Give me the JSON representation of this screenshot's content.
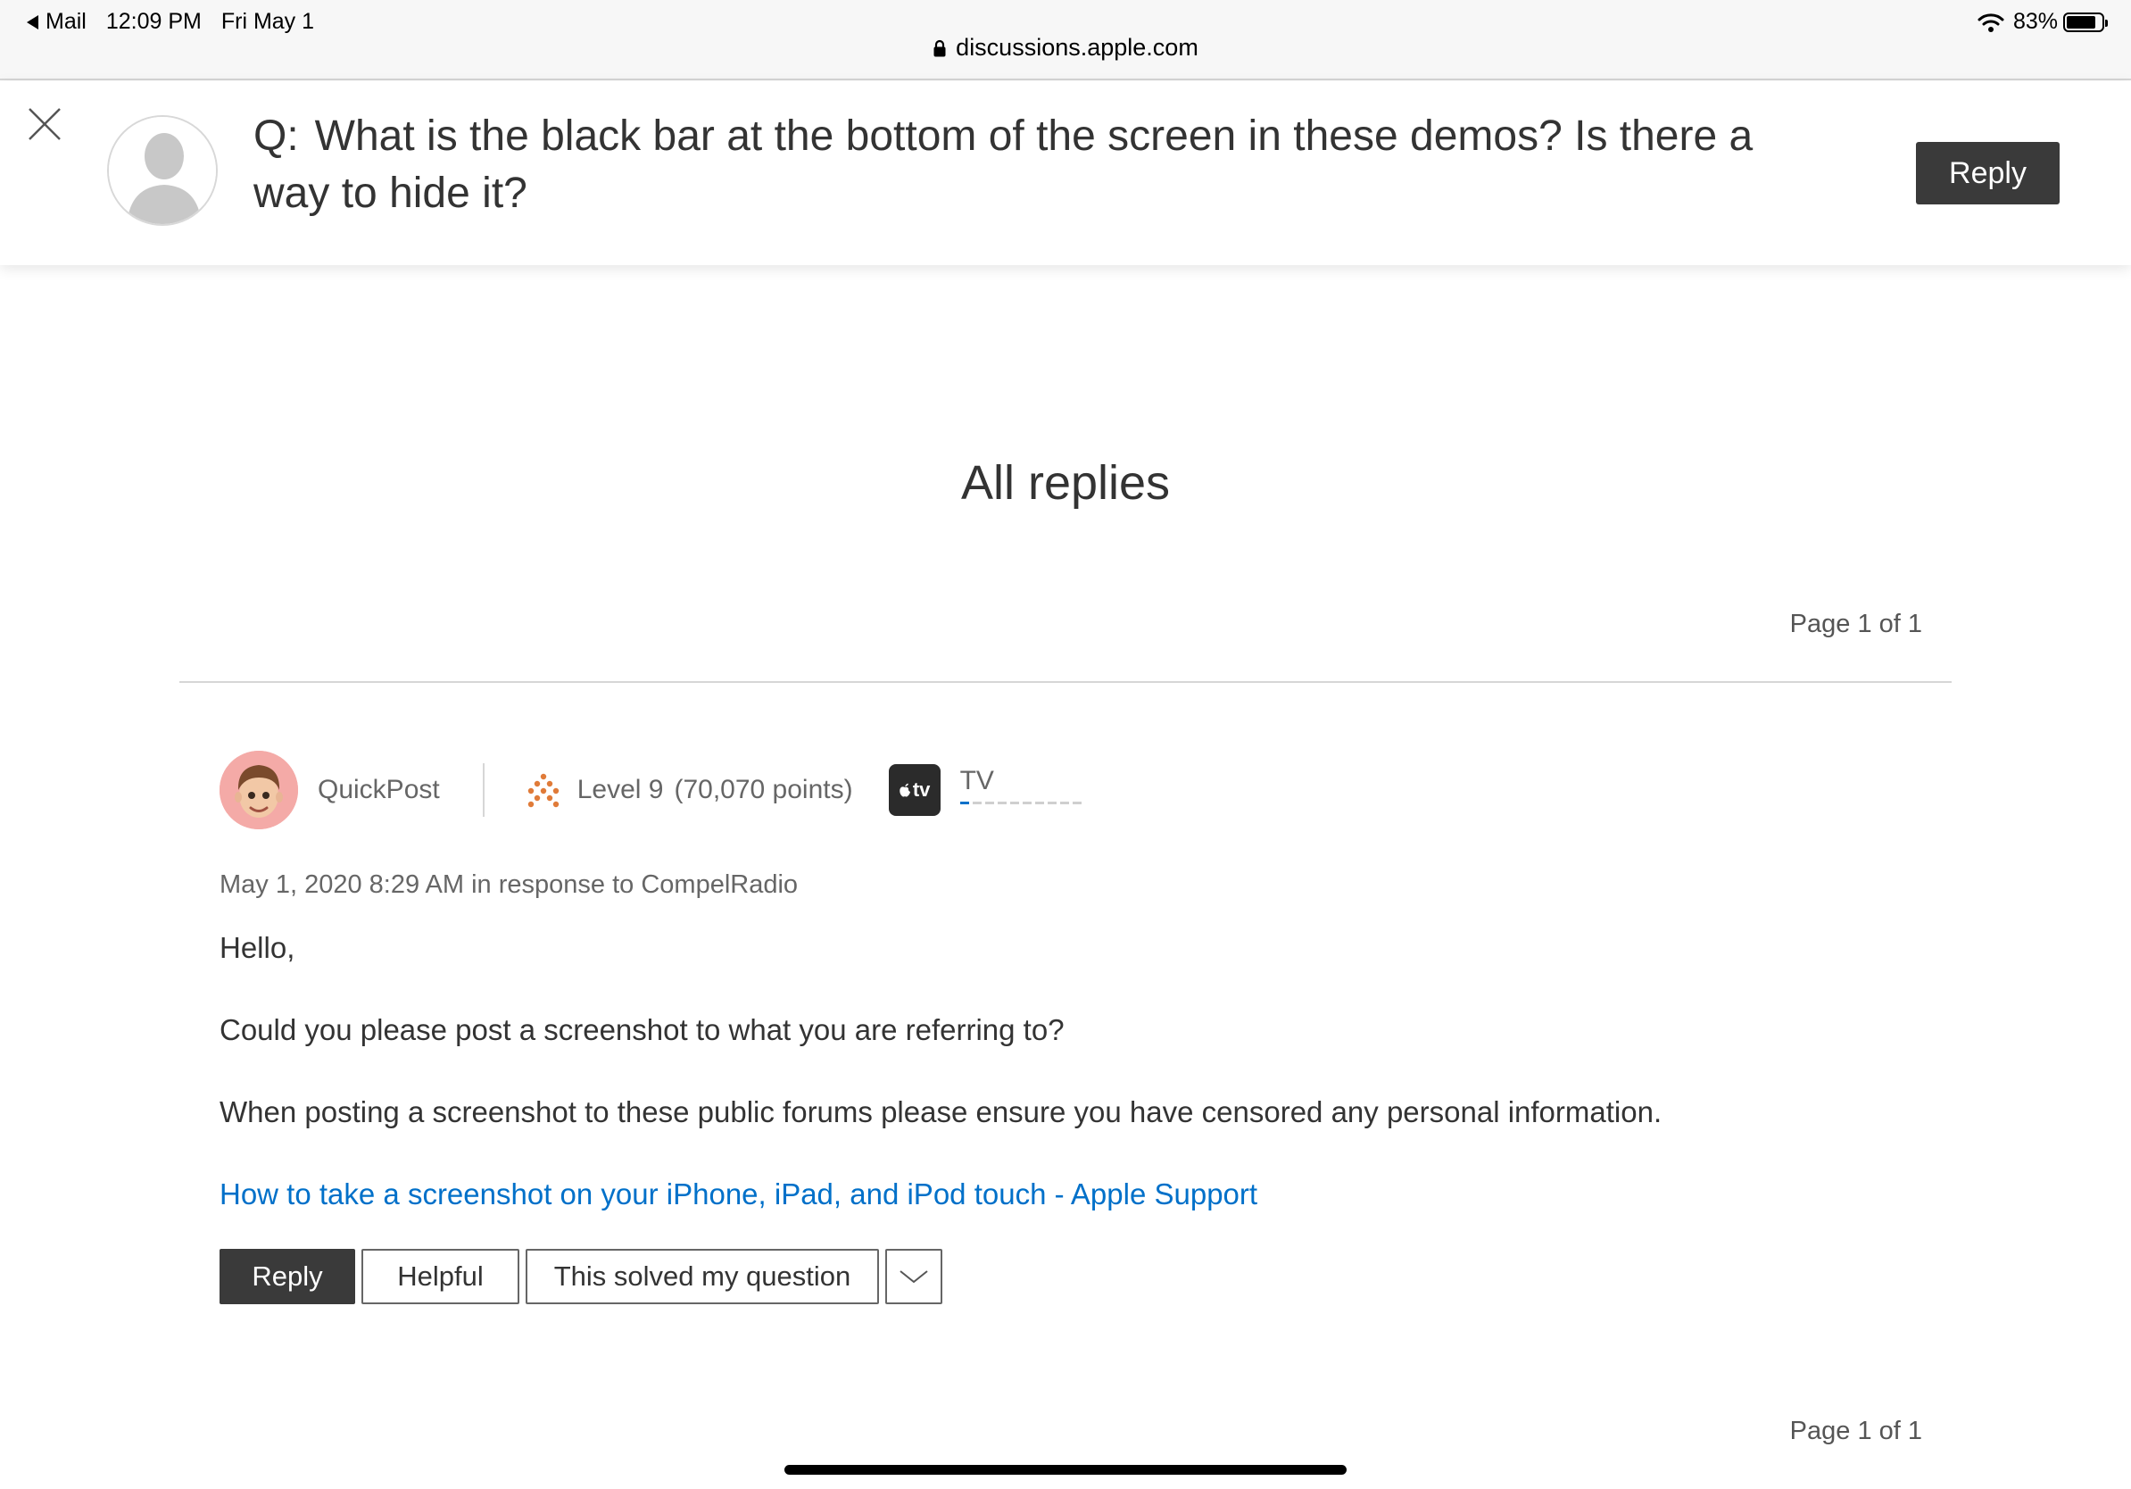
{
  "status_bar": {
    "back_app": "Mail",
    "time": "12:09 PM",
    "date": "Fri May 1",
    "battery": "83%",
    "url": "discussions.apple.com"
  },
  "question": {
    "label": "Q:",
    "title": "What is the black bar at the bottom of the screen in these demos? Is there a way to hide it?",
    "reply_label": "Reply"
  },
  "replies": {
    "heading": "All replies",
    "page_top": "Page 1 of 1",
    "page_bottom": "Page 1 of 1"
  },
  "post": {
    "author": "QuickPost",
    "level": "Level 9",
    "points": "(70,070 points)",
    "badge_text": "tv",
    "badge_label": "TV",
    "meta": "May 1, 2020 8:29 AM in response to CompelRadio",
    "greeting": "Hello,",
    "paragraph1": "Could you please post a screenshot to what you are referring to?",
    "paragraph2": "When posting a screenshot to these public forums please ensure you have censored any personal information.",
    "link_text": "How to take a screenshot on your iPhone, iPad, and iPod touch - Apple Support"
  },
  "actions": {
    "reply": "Reply",
    "helpful": "Helpful",
    "solved": "This solved my question"
  },
  "colors": {
    "link": "#0070c9",
    "dark_button": "#3a3a3a",
    "level_icon": "#e07b39"
  }
}
